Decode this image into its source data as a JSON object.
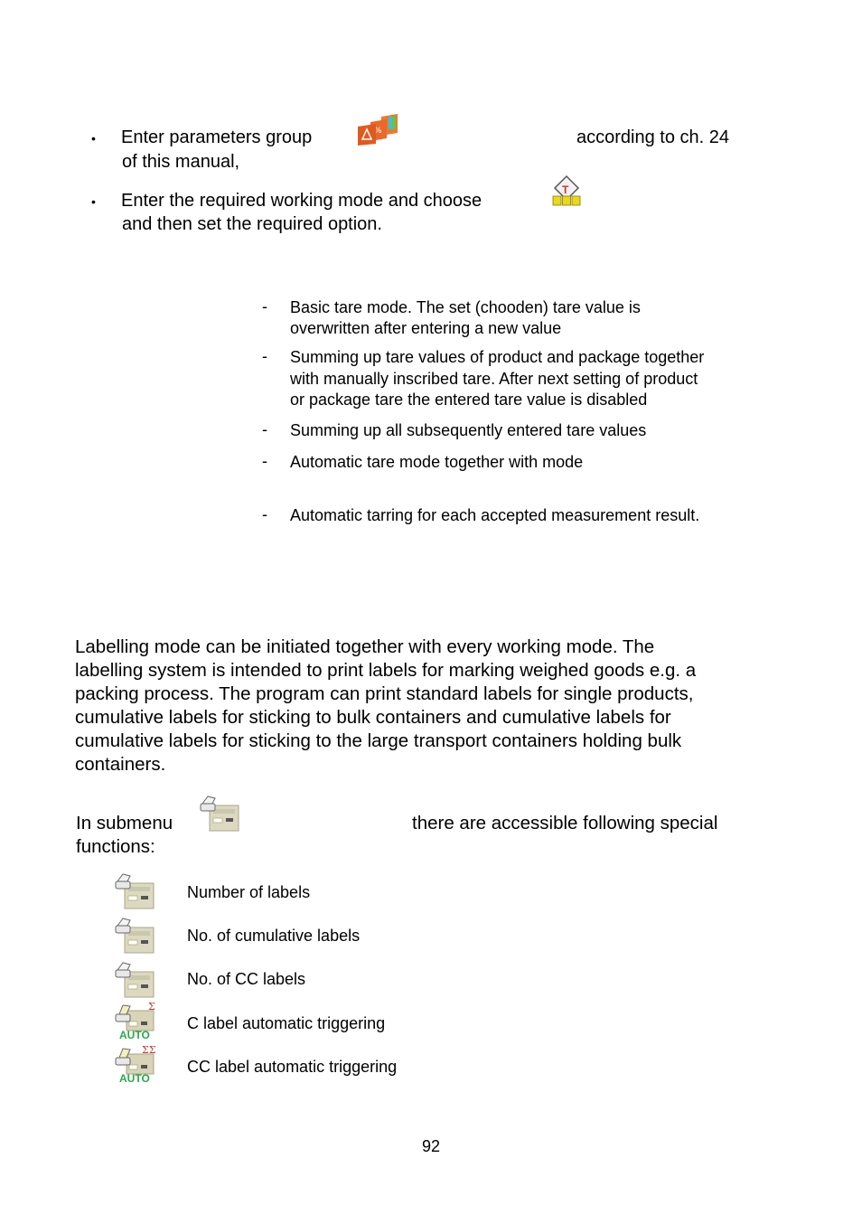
{
  "steps": [
    {
      "bullet": "•",
      "text_before": "Enter parameters group",
      "icon": "parameters-group-icon",
      "text_after": "according to ch. 24",
      "continuation": "of this manual,"
    },
    {
      "bullet": "•",
      "text_before": "Enter the required working mode and choose",
      "icon": "tare-mode-icon",
      "continuation": "and then set the required option."
    }
  ],
  "tare_options": [
    {
      "dash": "-",
      "lines": [
        "Basic tare mode. The set (chooden) tare value is",
        "overwritten after entering a new value"
      ]
    },
    {
      "dash": "-",
      "lines": [
        "Summing up tare values of product and package together",
        "with manually inscribed tare. After next setting of product",
        "or package tare the entered tare value is disabled"
      ]
    },
    {
      "dash": "-",
      "lines": [
        "Summing up all subsequently entered tare values"
      ]
    },
    {
      "dash": "-",
      "lines": [
        "Automatic tare mode together with mode"
      ]
    },
    {
      "dash": "-",
      "lines": [
        "Automatic tarring for each accepted measurement result."
      ]
    }
  ],
  "labelling": {
    "paragraph_lines": [
      "Labelling mode can be initiated together with every working mode. The",
      "labelling system is intended to print labels for marking weighed goods e.g. a",
      "packing process. The program can print standard labels for single products,",
      "cumulative labels for sticking to bulk containers and cumulative labels for",
      "cumulative labels for sticking to the large transport containers holding bulk",
      "containers."
    ],
    "submenu_text_before": "In submenu",
    "submenu_icon": "printer-label-icon",
    "submenu_text_after": "there are accessible following special",
    "submenu_continuation": "functions:"
  },
  "functions": [
    {
      "icon": "printer-label-icon",
      "label": "Number of labels"
    },
    {
      "icon": "printer-label-icon",
      "label": "No. of cumulative labels"
    },
    {
      "icon": "printer-label-icon",
      "label": "No. of CC labels"
    },
    {
      "icon": "auto-c-label-icon",
      "label": "C label automatic triggering",
      "badge": "AUTO",
      "sigma": "Σ"
    },
    {
      "icon": "auto-cc-label-icon",
      "label": "CC label automatic triggering",
      "badge": "AUTO",
      "sigma": "ΣΣ"
    }
  ],
  "page_number": "92",
  "colors": {
    "param_icon_orange": "#e8692a",
    "auto_green": "#2aa84a",
    "sigma_red": "#c0392b",
    "printer_beige": "#d9d6bc",
    "tare_yellow": "#e8d820"
  }
}
